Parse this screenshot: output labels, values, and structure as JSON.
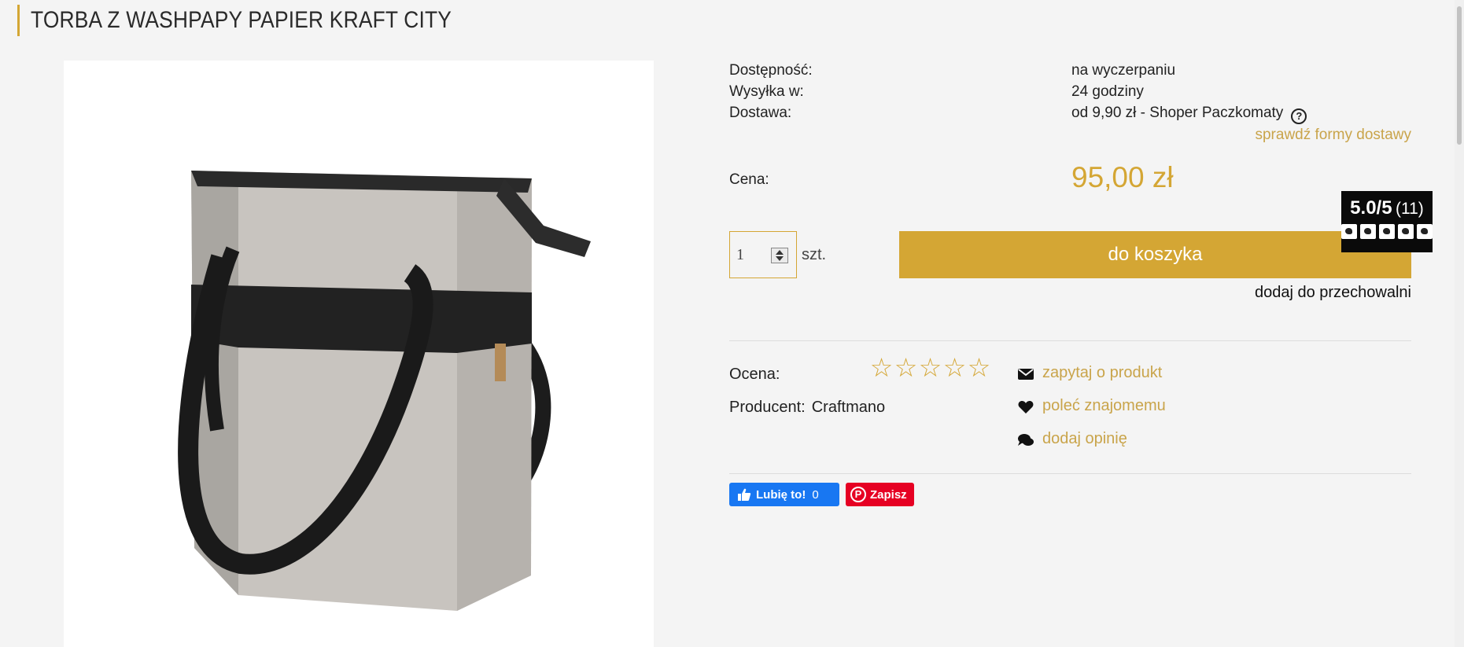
{
  "product": {
    "title": "TORBA Z WASHPAPY PAPIER KRAFT CITY"
  },
  "info": {
    "availability_label": "Dostępność:",
    "availability_value": "na wyczerpaniu",
    "shipping_label": "Wysyłka w:",
    "shipping_value": "24 godziny",
    "delivery_label": "Dostawa:",
    "delivery_value": "od 9,90 zł - Shoper Paczkomaty",
    "help_icon_glyph": "?",
    "check_delivery_link": "sprawdź formy dostawy"
  },
  "price": {
    "label": "Cena:",
    "value": "95,00 zł"
  },
  "cart": {
    "quantity": "1",
    "unit": "szt.",
    "button_label": "do koszyka",
    "storage_link": "dodaj do przechowalni"
  },
  "details": {
    "rating_label": "Ocena:",
    "stars": [
      "☆",
      "☆",
      "☆",
      "☆",
      "☆"
    ],
    "producer_label": "Producent:",
    "producer_value": "Craftmano"
  },
  "actions": {
    "ask": "zapytaj o produkt",
    "recommend": "poleć znajomemu",
    "review": "dodaj opinię"
  },
  "social": {
    "fb_label": "Lubię to!",
    "fb_count": "0",
    "pin_glyph": "P",
    "pin_label": "Zapisz"
  },
  "badge": {
    "score": "5.0/5",
    "count": "(11)"
  },
  "colors": {
    "accent": "#d4a634",
    "link": "#c9a44a",
    "facebook": "#1877f2",
    "pinterest": "#e60023"
  },
  "icons": {
    "ask": "envelope-icon",
    "recommend": "heart-icon",
    "review": "comments-icon"
  }
}
